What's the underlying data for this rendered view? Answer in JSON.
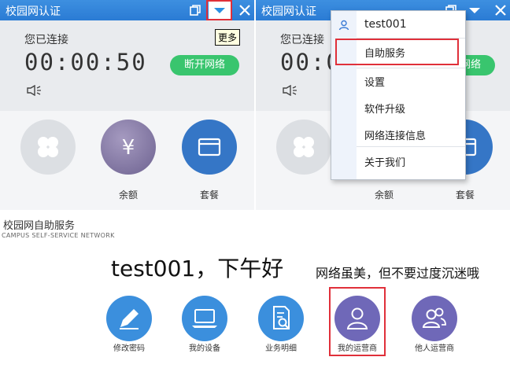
{
  "client": {
    "title": "校园网认证",
    "connection_status": "您已连接",
    "timer": "00:00:50",
    "disconnect_label": "断开网络",
    "tooltip_more": "更多",
    "tiles": [
      {
        "label": "",
        "icon": "clover-icon"
      },
      {
        "label": "余额",
        "icon": "yen-icon"
      },
      {
        "label": "套餐",
        "icon": "card-icon"
      }
    ]
  },
  "menu": {
    "username": "test001",
    "items": [
      "自助服务",
      "设置",
      "软件升级",
      "网络连接信息",
      "关于我们"
    ]
  },
  "portal": {
    "title": "校园网自助服务",
    "subtitle": "CAMPUS SELF-SERVICE NETWORK",
    "greeting": "test001，下午好",
    "slogan": "网络虽美，但不要过度沉迷哦",
    "services": [
      {
        "label": "修改密码",
        "icon": "pencil-icon"
      },
      {
        "label": "我的设备",
        "icon": "laptop-icon"
      },
      {
        "label": "业务明细",
        "icon": "document-search-icon"
      },
      {
        "label": "我的运营商",
        "icon": "person-icon"
      },
      {
        "label": "他人运营商",
        "icon": "group-icon"
      }
    ]
  },
  "colors": {
    "titlebar": "#2a7bd4",
    "connect_green": "#39c56e",
    "highlight_red": "#e0303a",
    "tile_gray": "#dcdfe3",
    "tile_purple": "#7a6fa0",
    "tile_blue": "#3576c6",
    "svc_blue": "#3b8fdd",
    "svc_purple": "#6f68b8"
  }
}
